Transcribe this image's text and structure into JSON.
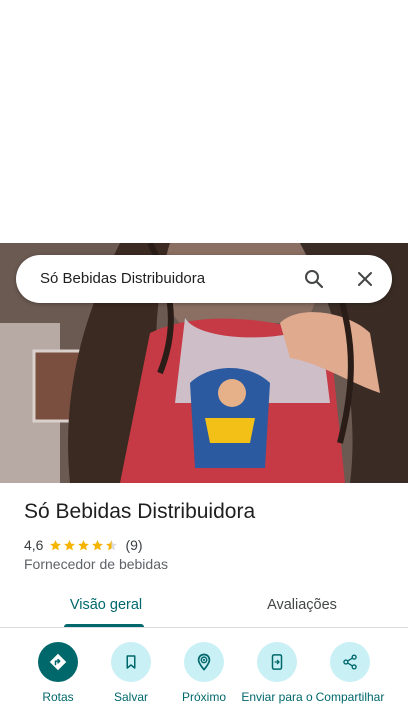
{
  "search": {
    "query": "Só Bebidas Distribuidora"
  },
  "place": {
    "name": "Só Bebidas Distribuidora",
    "rating": "4,6",
    "stars": 4.5,
    "review_count": "(9)",
    "category": "Fornecedor de bebidas"
  },
  "tabs": [
    {
      "label": "Visão geral",
      "selected": true
    },
    {
      "label": "Avaliações",
      "selected": false
    }
  ],
  "actions": [
    {
      "label": "Rotas",
      "icon": "directions-icon"
    },
    {
      "label": "Salvar",
      "icon": "bookmark-icon"
    },
    {
      "label": "Próximo",
      "icon": "nearby-icon"
    },
    {
      "label": "Enviar para o",
      "icon": "send-to-phone-icon"
    },
    {
      "label": "Compartilhar",
      "icon": "share-icon"
    }
  ],
  "colors": {
    "accent": "#00686b",
    "accent_light": "#c8f0f5",
    "star": "#f4b400"
  }
}
